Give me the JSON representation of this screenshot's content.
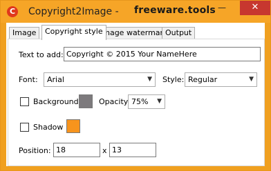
{
  "window": {
    "app_icon": "C",
    "title": "Copyright2Image -",
    "site": "freeware.tools",
    "minimize": "—",
    "maximize": "☐",
    "close": "✕"
  },
  "tabs": [
    {
      "label": "Image",
      "active": false
    },
    {
      "label": "Copyright style",
      "active": true
    },
    {
      "label": "Image watermark",
      "active": false
    },
    {
      "label": "Output",
      "active": false
    }
  ],
  "form": {
    "text_label": "Text to add:",
    "text_value": "Copyright © 2015 Your NameHere",
    "font_label": "Font:",
    "font_value": "Arial",
    "style_label": "Style:",
    "style_value": "Regular",
    "background_label": "Background",
    "background_checked": false,
    "background_color": "#7d7a7d",
    "opacity_label": "Opacity:",
    "opacity_value": "75%",
    "shadow_label": "Shadow",
    "shadow_checked": false,
    "shadow_color": "#f7941d",
    "position_label": "Position:",
    "position_x": "18",
    "position_sep": "x",
    "position_y": "13"
  },
  "icons": {
    "dropdown_arrow": "chevron-down-icon",
    "app_icon": "app-logo-icon"
  }
}
